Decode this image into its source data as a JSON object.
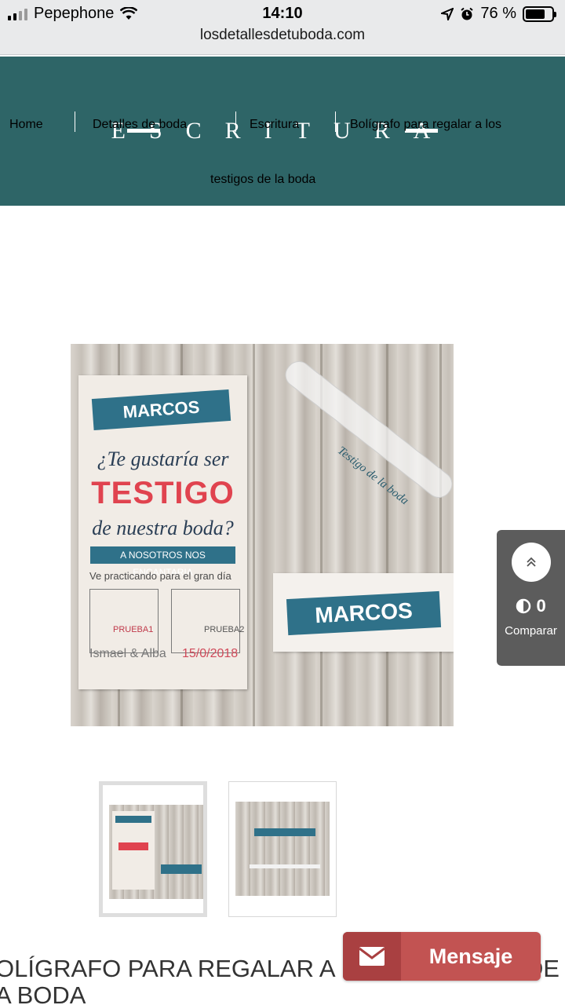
{
  "status_bar": {
    "carrier": "Pepephone",
    "time": "14:10",
    "battery_percent": "76 %",
    "battery_level": 0.76,
    "url": "losdetallesdetuboda.com"
  },
  "header": {
    "brand": "ESCRITURA",
    "breadcrumbs": [
      "Home",
      "Detalles de boda",
      "Escritura",
      "Bolígrafo para regalar a los",
      "testigos de la boda"
    ]
  },
  "product_image": {
    "card_name": "MARCOS",
    "card_question_1": "¿Te gustaría ser",
    "card_question_2": "TESTIGO",
    "card_question_3": "de nuestra boda?",
    "card_banner": "A NOSOTROS NOS ENCANTARIA",
    "card_practice": "Ve practicando para el gran día",
    "box_label_1": "PRUEBA1",
    "box_label_2": "PRUEBA2",
    "card_names": "Ismael & Alba",
    "card_date": "15/0/2018",
    "tube_text": "Testigo de la boda",
    "second_card_name": "MARCOS"
  },
  "compare_widget": {
    "count": "0",
    "label": "Comparar"
  },
  "product_title": {
    "line1": "OLÍGRAFO PARA REGALAR A LOS TESTIGOS DE L",
    "line2": "A BODA"
  },
  "message_button": {
    "label": "Mensaje"
  },
  "colors": {
    "header_teal": "#2e6567",
    "message_red": "#c25352",
    "compare_gray": "#5c5c5c"
  },
  "icons": [
    "wifi-icon",
    "location-icon",
    "alarm-icon",
    "battery-icon",
    "scroll-up-icon",
    "compare-icon",
    "mail-icon"
  ]
}
